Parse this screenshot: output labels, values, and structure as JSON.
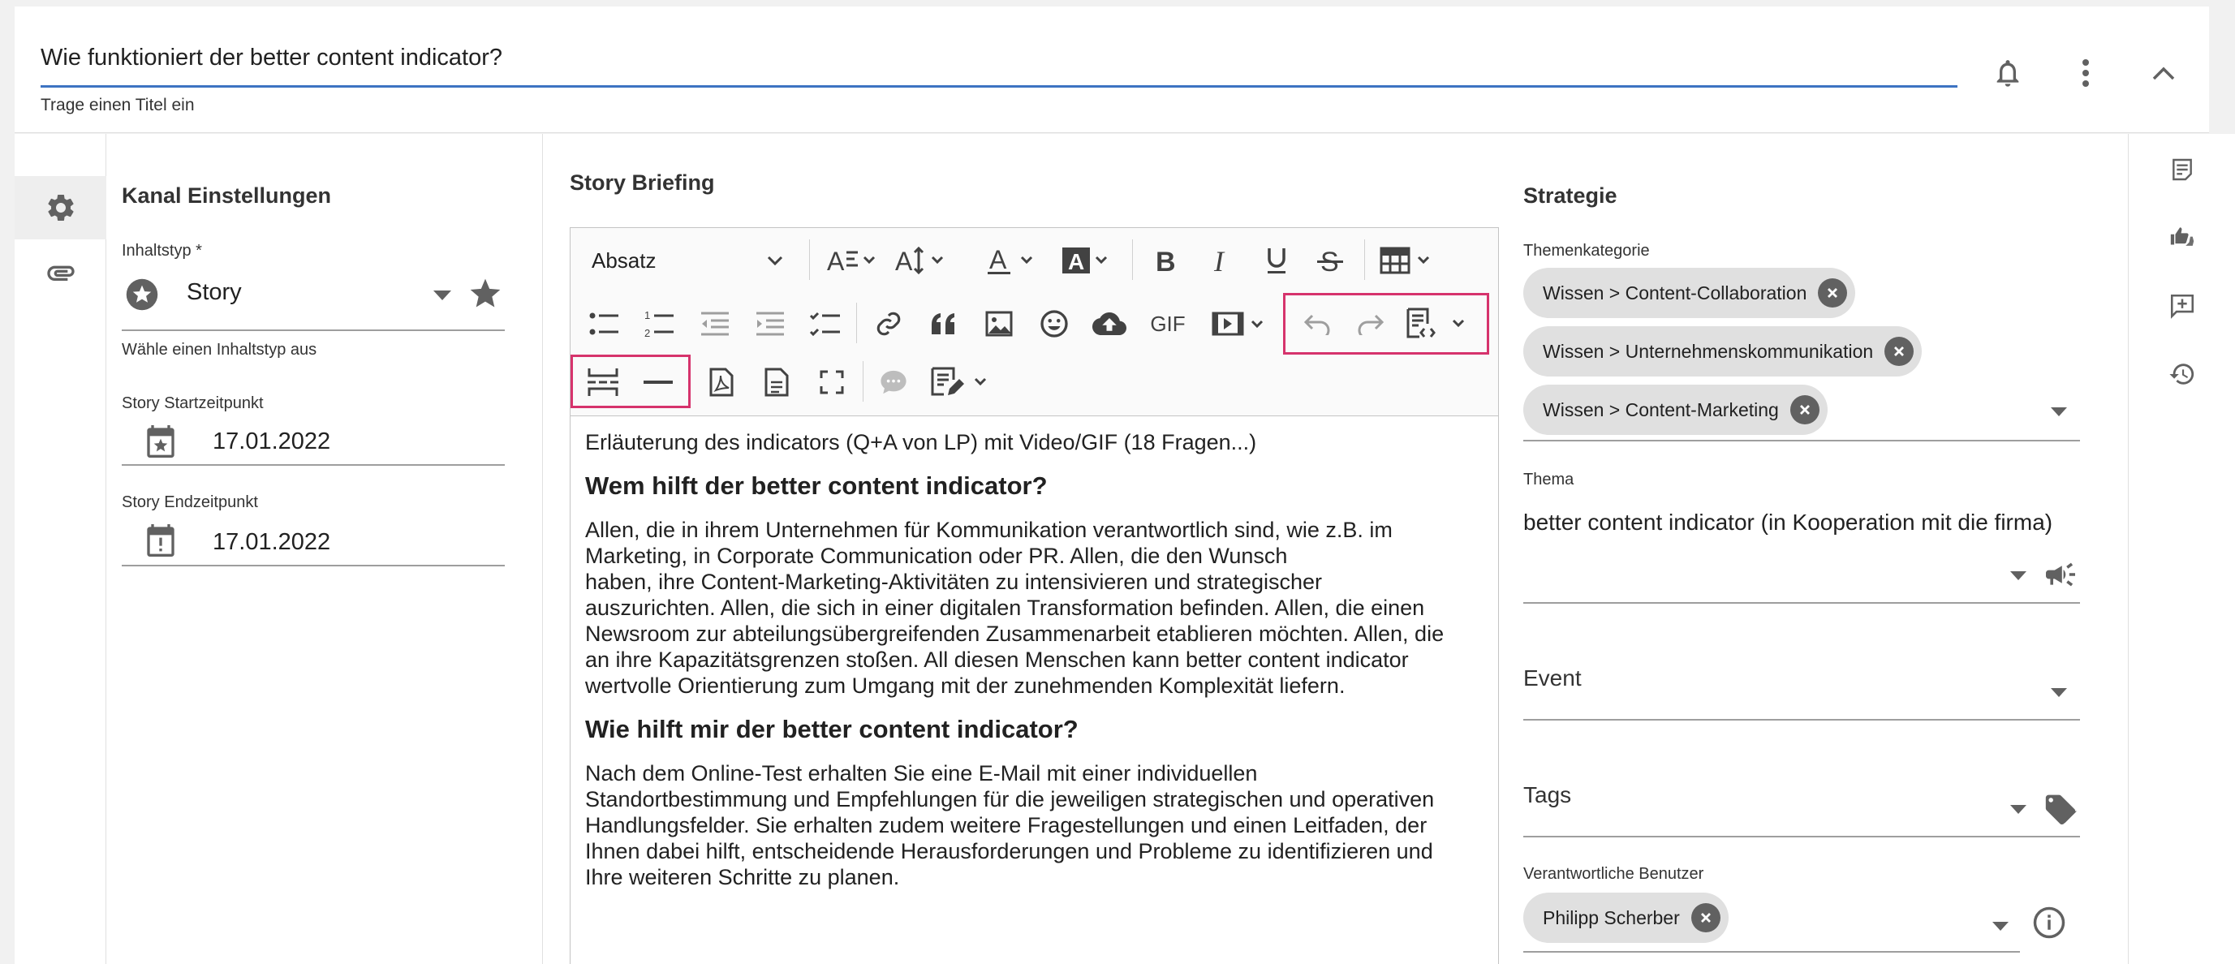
{
  "header": {
    "title_value": "Wie funktioniert der better content indicator?",
    "title_hint": "Trage einen Titel ein"
  },
  "channel": {
    "section_title": "Kanal Einstellungen",
    "content_type_label": "Inhaltstyp *",
    "content_type_value": "Story",
    "content_type_hint": "Wähle einen Inhaltstyp aus",
    "start_label": "Story Startzeitpunkt",
    "start_value": "17.01.2022",
    "end_label": "Story Endzeitpunkt",
    "end_value": "17.01.2022"
  },
  "briefing": {
    "section_title": "Story Briefing",
    "paragraph_style": "Absatz",
    "gif_label": "GIF",
    "content": {
      "intro": "Erläuterung des indicators (Q+A von LP) mit Video/GIF (18 Fragen...)",
      "h1": "Wem hilft der better content indicator?",
      "p1_l1": "Allen, die in ihrem Unternehmen für Kommunikation verantwortlich sind, wie z.B. im",
      "p1_l2": "Marketing, in Corporate Communication oder PR. Allen, die den Wunsch",
      "p1_l3": "haben, ihre Content-Marketing-Aktivitäten zu intensivieren und strategischer",
      "p1_l4": "auszurichten. Allen, die sich in einer digitalen Transformation befinden. Allen, die einen",
      "p1_l5": "Newsroom zur abteilungsübergreifenden Zusammenarbeit etablieren möchten. Allen, die",
      "p1_l6": "an ihre Kapazitätsgrenzen stoßen. All diesen Menschen kann better content indicator",
      "p1_l7": "wertvolle Orientierung zum Umgang mit der zunehmenden Komplexität liefern.",
      "h2": "Wie hilft mir der better content indicator?",
      "p2_l1": "Nach dem Online-Test erhalten Sie eine E-Mail mit einer individuellen",
      "p2_l2": "Standortbestimmung und Empfehlungen für die jeweiligen strategischen und operativen",
      "p2_l3": "Handlungsfelder. Sie erhalten zudem weitere Fragestellungen und einen Leitfaden, der",
      "p2_l4": "Ihnen dabei hilft, entscheidende Herausforderungen und Probleme zu identifizieren und",
      "p2_l5": "Ihre weiteren Schritte zu planen."
    }
  },
  "strategy": {
    "section_title": "Strategie",
    "category_label": "Themenkategorie",
    "categories": [
      "Wissen > Content-Collaboration",
      "Wissen > Unternehmenskommunikation",
      "Wissen > Content-Marketing"
    ],
    "topic_label": "Thema",
    "topic_value": "better content indicator (in Kooperation mit die firma)",
    "event_label": "Event",
    "tags_label": "Tags",
    "users_label": "Verantwortliche Benutzer",
    "users": [
      "Philipp Scherber"
    ]
  },
  "colors": {
    "accent": "#3d73c2",
    "highlight": "#d6336c",
    "chip_bg": "#e0e0e0"
  }
}
